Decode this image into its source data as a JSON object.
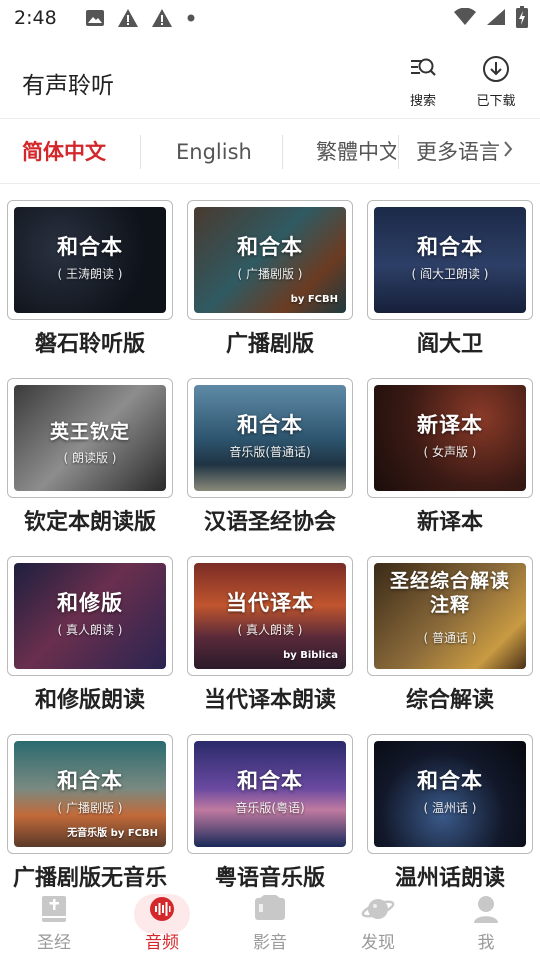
{
  "status_bar": {
    "time": "2:48",
    "left_icons": [
      "image-icon",
      "warning-icon",
      "warning-icon",
      "dot-icon"
    ],
    "right_icons": [
      "wifi-icon",
      "signal-icon",
      "battery-charging-icon"
    ]
  },
  "header": {
    "title": "有声聆听",
    "search_label": "搜索",
    "downloaded_label": "已下载"
  },
  "language_tabs": {
    "items": [
      "简体中文",
      "English",
      "繁體中文",
      "更多语言"
    ],
    "active": "简体中文",
    "accent_color": "#d4272b"
  },
  "cards": [
    {
      "thumb_title": "和合本",
      "thumb_sub": "( 王涛朗读 )",
      "credit": "",
      "label": "磐石聆听版"
    },
    {
      "thumb_title": "和合本",
      "thumb_sub": "( 广播剧版 )",
      "credit": "by FCBH",
      "label": "广播剧版"
    },
    {
      "thumb_title": "和合本",
      "thumb_sub": "( 阎大卫朗读 )",
      "credit": "",
      "label": "阎大卫"
    },
    {
      "thumb_title": "英王钦定",
      "thumb_sub": "( 朗读版 )",
      "credit": "",
      "label": "钦定本朗读版"
    },
    {
      "thumb_title": "和合本",
      "thumb_sub": "音乐版(普通话)",
      "credit": "",
      "label": "汉语圣经协会"
    },
    {
      "thumb_title": "新译本",
      "thumb_sub": "( 女声版 )",
      "credit": "",
      "label": "新译本"
    },
    {
      "thumb_title": "和修版",
      "thumb_sub": "( 真人朗读 )",
      "credit": "",
      "label": "和修版朗读"
    },
    {
      "thumb_title": "当代译本",
      "thumb_sub": "( 真人朗读 )",
      "credit": "by Biblica",
      "label": "当代译本朗读"
    },
    {
      "thumb_title": "圣经综合解读注释",
      "thumb_sub": "( 普通话 )",
      "credit": "",
      "label": "综合解读"
    },
    {
      "thumb_title": "和合本",
      "thumb_sub": "( 广播剧版 )",
      "credit": "无音乐版 by FCBH",
      "label": "广播剧版无音乐"
    },
    {
      "thumb_title": "和合本",
      "thumb_sub": "音乐版(粤语)",
      "credit": "",
      "label": "粤语音乐版"
    },
    {
      "thumb_title": "和合本",
      "thumb_sub": "( 温州话 )",
      "credit": "",
      "label": "温州话朗读"
    }
  ],
  "bottom_nav": {
    "items": [
      "圣经",
      "音频",
      "影音",
      "发现",
      "我"
    ],
    "active": "音频",
    "inactive_color": "#9a9a9a"
  }
}
